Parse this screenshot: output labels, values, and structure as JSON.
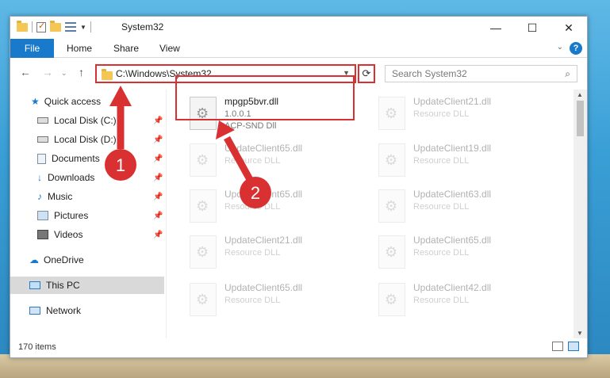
{
  "window": {
    "title": "System32",
    "controls": {
      "minimize": "—",
      "maximize": "☐",
      "close": "✕"
    }
  },
  "ribbon": {
    "tabs": [
      "File",
      "Home",
      "Share",
      "View"
    ],
    "help": "?"
  },
  "address": {
    "path": "C:\\Windows\\System32",
    "search_placeholder": "Search System32"
  },
  "nav": {
    "quick_access": "Quick access",
    "items": [
      {
        "label": "Local Disk (C:)",
        "icon": "drive-icon"
      },
      {
        "label": "Local Disk (D:)",
        "icon": "drive-icon"
      },
      {
        "label": "Documents",
        "icon": "documents-icon"
      },
      {
        "label": "Downloads",
        "icon": "downloads-icon"
      },
      {
        "label": "Music",
        "icon": "music-icon"
      },
      {
        "label": "Pictures",
        "icon": "pictures-icon"
      },
      {
        "label": "Videos",
        "icon": "videos-icon"
      }
    ],
    "onedrive": "OneDrive",
    "this_pc": "This PC",
    "network": "Network"
  },
  "files": [
    {
      "name": "mpgp5bvr.dll",
      "line2": "1.0.0.1",
      "line3": "ACP-SND Dll"
    },
    {
      "name": "UpdateClient21.dll",
      "line2": "Resource DLL"
    },
    {
      "name": "UpdateClient65.dll",
      "line2": "Resource DLL"
    },
    {
      "name": "UpdateClient19.dll",
      "line2": "Resource DLL"
    },
    {
      "name": "UpdateClient65.dll",
      "line2": "Resource DLL"
    },
    {
      "name": "UpdateClient63.dll",
      "line2": "Resource DLL"
    },
    {
      "name": "UpdateClient21.dll",
      "line2": "Resource DLL"
    },
    {
      "name": "UpdateClient65.dll",
      "line2": "Resource DLL"
    },
    {
      "name": "UpdateClient65.dll",
      "line2": "Resource DLL"
    },
    {
      "name": "UpdateClient42.dll",
      "line2": "Resource DLL"
    }
  ],
  "status": {
    "count": "170 items"
  },
  "annotations": {
    "step1": "1",
    "step2": "2",
    "color": "#d93131"
  }
}
